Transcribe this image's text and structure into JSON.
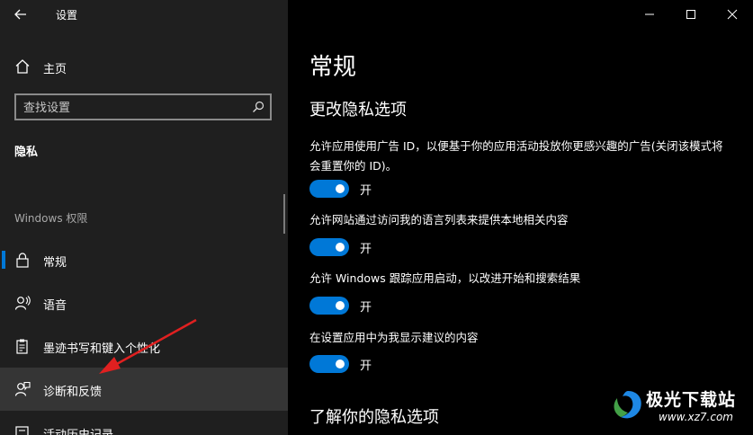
{
  "window": {
    "title": "设置",
    "controls": [
      "minimize-icon",
      "maximize-icon",
      "close-icon"
    ]
  },
  "sidebar": {
    "home_label": "主页",
    "search_placeholder": "查找设置",
    "section_heading": "隐私",
    "group_label": "Windows 权限",
    "items": [
      {
        "label": "常规",
        "icon": "lock-icon",
        "selected": true
      },
      {
        "label": "语音",
        "icon": "speech-icon",
        "selected": false
      },
      {
        "label": "墨迹书写和键入个性化",
        "icon": "clipboard-icon",
        "selected": false
      },
      {
        "label": "诊断和反馈",
        "icon": "feedback-icon",
        "selected": false,
        "hovered": true
      },
      {
        "label": "活动历史记录",
        "icon": "history-icon",
        "selected": false
      }
    ]
  },
  "main": {
    "page_title": "常规",
    "subtitle": "更改隐私选项",
    "options": [
      {
        "desc": "允许应用使用广告 ID，以便基于你的应用活动投放你更感兴趣的广告(关闭该模式将会重置你的 ID)。",
        "toggle_label": "开",
        "on": true
      },
      {
        "desc": "允许网站通过访问我的语言列表来提供本地相关内容",
        "toggle_label": "开",
        "on": true
      },
      {
        "desc": "允许 Windows 跟踪应用启动，以改进开始和搜索结果",
        "toggle_label": "开",
        "on": true
      },
      {
        "desc": "在设置应用中为我显示建议的内容",
        "toggle_label": "开",
        "on": true
      }
    ],
    "learn_title": "了解你的隐私选项"
  },
  "watermark": {
    "name": "极光下载站",
    "url": "www.xz7.com"
  },
  "colors": {
    "accent": "#0078d7",
    "annotation_arrow": "#e02020",
    "sidebar_bg": "#1f1f1f",
    "content_bg": "#000000"
  }
}
